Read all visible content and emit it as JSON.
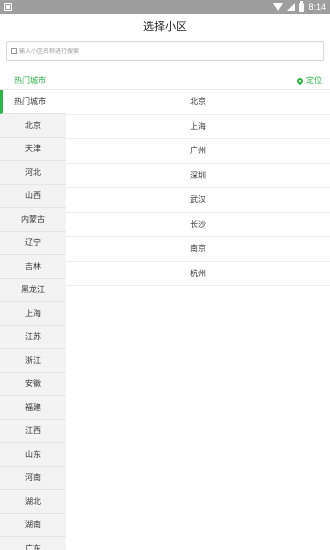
{
  "status_bar": {
    "time": "8:14",
    "icons": [
      "app-notification-icon",
      "wifi-icon",
      "signal-icon",
      "battery-icon"
    ]
  },
  "header": {
    "title": "选择小区"
  },
  "search": {
    "placeholder": "输入小区名称进行搜索",
    "value": ""
  },
  "hot_bar": {
    "label": "热门城市",
    "locate_label": "定位",
    "accent_color": "#2eb34a"
  },
  "sidebar": {
    "active": "热门城市",
    "items": [
      "热门城市",
      "北京",
      "天津",
      "河北",
      "山西",
      "内蒙古",
      "辽宁",
      "吉林",
      "黑龙江",
      "上海",
      "江苏",
      "浙江",
      "安徽",
      "福建",
      "江西",
      "山东",
      "河南",
      "湖北",
      "湖南",
      "广东"
    ]
  },
  "cities": [
    "北京",
    "上海",
    "广州",
    "深圳",
    "武汉",
    "长沙",
    "南京",
    "杭州"
  ]
}
